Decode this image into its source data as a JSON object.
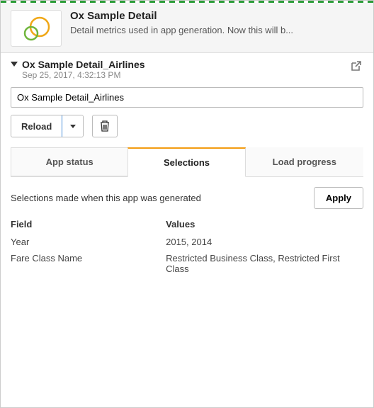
{
  "header": {
    "title": "Ox Sample Detail",
    "description": "Detail metrics used in app generation. Now this will b..."
  },
  "instance": {
    "name": "Ox Sample Detail_Airlines",
    "timestamp": "Sep 25, 2017, 4:32:13 PM",
    "input_value": "Ox Sample Detail_Airlines"
  },
  "toolbar": {
    "reload_label": "Reload"
  },
  "tabs": [
    {
      "label": "App status",
      "active": false
    },
    {
      "label": "Selections",
      "active": true
    },
    {
      "label": "Load progress",
      "active": false
    }
  ],
  "selections_panel": {
    "description": "Selections made when this app was generated",
    "apply_label": "Apply",
    "col_field": "Field",
    "col_values": "Values",
    "rows": [
      {
        "field": "Year",
        "values": "2015, 2014"
      },
      {
        "field": "Fare Class Name",
        "values": "Restricted Business Class, Restricted First Class"
      }
    ]
  }
}
